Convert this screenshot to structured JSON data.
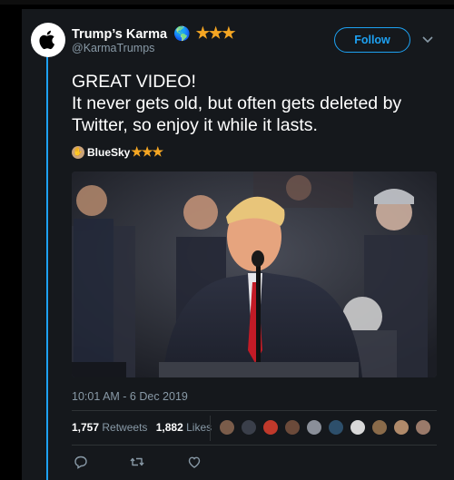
{
  "tweet": {
    "display_name": "Trump’s Karma",
    "name_emoji": "🌎",
    "name_stars": "★★★",
    "handle": "@KarmaTrumps",
    "follow_label": "Follow",
    "text_line1": "GREAT VIDEO!",
    "text_line2": "It never gets old, but often gets deleted by Twitter, so enjoy it while it lasts.",
    "quoted_author": "BlueSky",
    "quoted_stars": "★★★",
    "timestamp": "10:01 AM - 6 Dec 2019",
    "retweets_count": "1,757",
    "retweets_label": "Retweets",
    "likes_count": "1,882",
    "likes_label": "Likes"
  },
  "colors": {
    "accent": "#1da1f2",
    "background": "#15181c",
    "muted_text": "#8899a6",
    "stars": "#f5a623"
  },
  "icons": {
    "avatar": "apple-logo-icon",
    "caret": "chevron-down-icon",
    "reply": "reply-icon",
    "retweet": "retweet-icon",
    "like": "heart-icon"
  },
  "liker_avatars": [
    "#7a5c4a",
    "#3a3f4a",
    "#c0392b",
    "#6b4a3a",
    "#8a8f99",
    "#2d4f6b",
    "#d8d8d8",
    "#8a6b4a",
    "#b08a6a",
    "#9a7a6a"
  ]
}
